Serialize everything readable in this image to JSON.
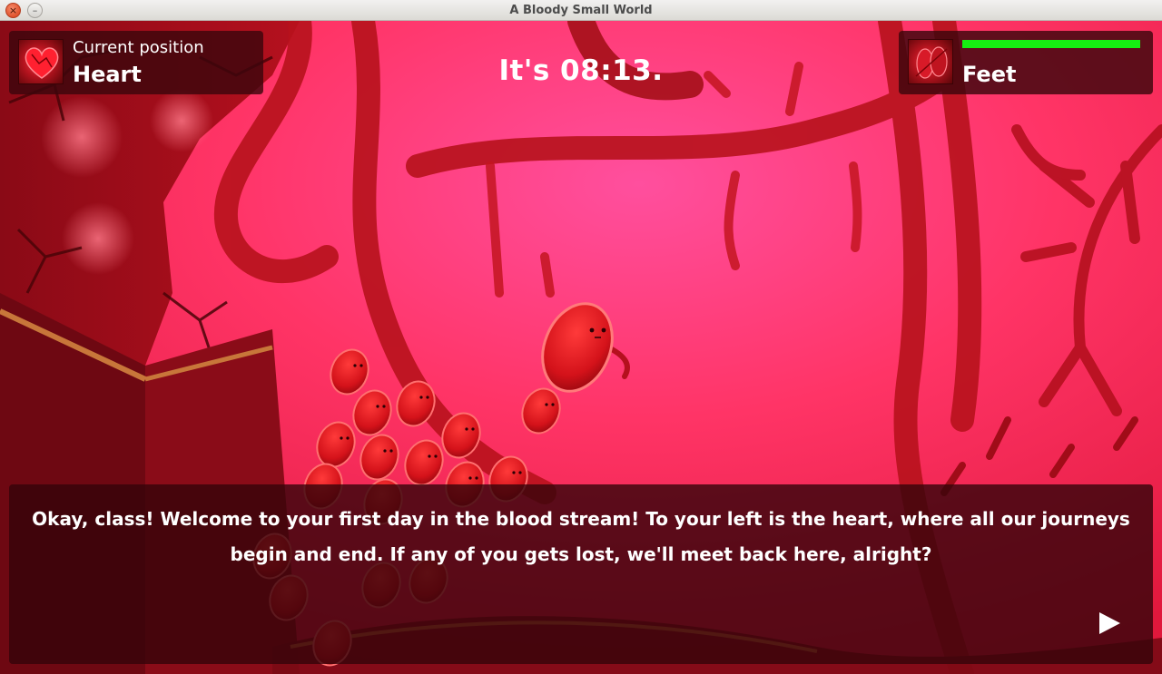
{
  "window": {
    "title": "A Bloody Small World"
  },
  "hud": {
    "position_label": "Current position",
    "position_value": "Heart",
    "clock_text": "It's 08:13.",
    "destination_value": "Feet",
    "energy_fraction": 1.0,
    "energy_color": "#16ee12"
  },
  "dialog": {
    "text": "Okay, class! Welcome to your first day in the blood stream! To your left is the heart, where all our journeys begin and end. If any of you gets lost, we'll meet back here, alright?",
    "next_icon": "play-triangle-icon"
  },
  "colors": {
    "background_pink": "#ff3b6a",
    "vessel_red": "#c4151f",
    "cell_red": "#e01a22"
  }
}
